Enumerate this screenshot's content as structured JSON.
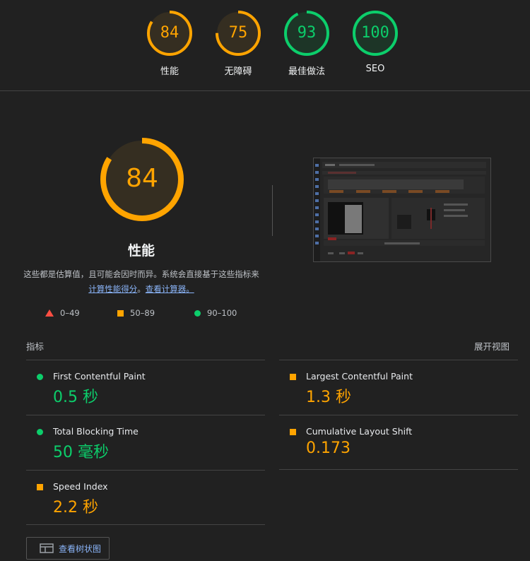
{
  "scores": [
    {
      "label": "性能",
      "value": "84",
      "score": 84,
      "color": "#ffa400"
    },
    {
      "label": "无障碍",
      "value": "75",
      "score": 75,
      "color": "#ffa400"
    },
    {
      "label": "最佳做法",
      "value": "93",
      "score": 93,
      "color": "#0cce6b"
    },
    {
      "label": "SEO",
      "value": "100",
      "score": 100,
      "color": "#0cce6b"
    }
  ],
  "performance": {
    "score": 84,
    "score_text": "84",
    "title": "性能",
    "desc_prefix": "这些都是估算值，且可能会因时而异。系统会直接基于这些指标来",
    "link1": "计算性能得分",
    "desc_mid": "。",
    "link2": "查看计算器。"
  },
  "legend": [
    {
      "shape": "triangle",
      "range": "0–49",
      "color": "#ff4e42"
    },
    {
      "shape": "square",
      "range": "50–89",
      "color": "#ffa400"
    },
    {
      "shape": "circle",
      "range": "90–100",
      "color": "#0cce6b"
    }
  ],
  "metrics_header": {
    "title": "指标",
    "expand": "展开视图"
  },
  "metrics": [
    {
      "name": "First Contentful Paint",
      "value": "0.5 秒",
      "status": "pass"
    },
    {
      "name": "Largest Contentful Paint",
      "value": "1.3 秒",
      "status": "average"
    },
    {
      "name": "Total Blocking Time",
      "value": "50 毫秒",
      "status": "pass"
    },
    {
      "name": "Cumulative Layout Shift",
      "value": "0.173",
      "status": "average"
    },
    {
      "name": "Speed Index",
      "value": "2.2 秒",
      "status": "average"
    }
  ],
  "tree_button": "查看树状图",
  "colors": {
    "pass": "#0cce6b",
    "average": "#ffa400",
    "fail": "#ff4e42",
    "background": "#212121",
    "link": "#8ab4f8"
  }
}
